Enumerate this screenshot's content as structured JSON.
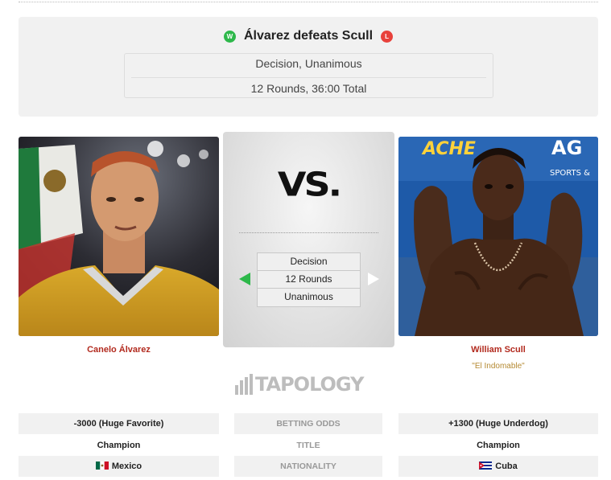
{
  "result": {
    "winner_badge": "W",
    "headline": "Álvarez defeats Scull",
    "loser_badge": "L",
    "method": "Decision, Unanimous",
    "duration": "12 Rounds, 36:00 Total"
  },
  "fighters": {
    "left": {
      "name": "Canelo Álvarez"
    },
    "right": {
      "name": "William Scull",
      "nickname": "\"El Indomable\""
    }
  },
  "vs_panel": {
    "vs_text": "VS.",
    "details": [
      "Decision",
      "12 Rounds",
      "Unanimous"
    ]
  },
  "logo": {
    "text": "TAPOLOGY"
  },
  "stats": [
    {
      "label": "BETTING ODDS",
      "left": "-3000 (Huge Favorite)",
      "right": "+1300 (Huge Underdog)"
    },
    {
      "label": "TITLE",
      "left": "Champion",
      "right": "Champion"
    },
    {
      "label": "NATIONALITY",
      "left": "Mexico",
      "right": "Cuba"
    }
  ],
  "colors": {
    "win": "#2db84a",
    "loss": "#e8413b",
    "fighter_name": "#b22a1e",
    "nickname": "#b58a33"
  },
  "icons": {
    "left_arrow": "green-triangle-left",
    "right_arrow": "white-triangle-right",
    "mexico_flag": "mexico-flag-icon",
    "cuba_flag": "cuba-flag-icon"
  }
}
